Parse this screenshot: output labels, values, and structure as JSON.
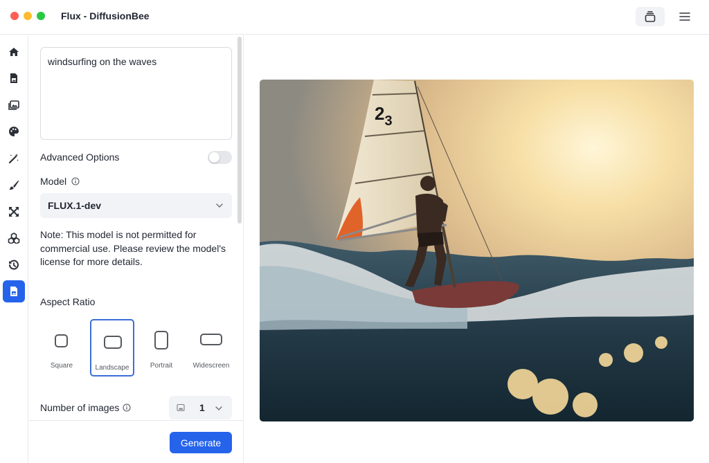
{
  "window": {
    "title": "Flux - DiffusionBee"
  },
  "toolbar": {
    "icons": [
      "stack-icon",
      "hamburger-menu-icon"
    ]
  },
  "rail": {
    "items": [
      {
        "icon": "home-icon"
      },
      {
        "icon": "document-image-icon"
      },
      {
        "icon": "images-icon"
      },
      {
        "icon": "palette-icon"
      },
      {
        "icon": "magic-wand-icon"
      },
      {
        "icon": "brush-icon"
      },
      {
        "icon": "expand-arrows-icon"
      },
      {
        "icon": "models-cube-icon"
      },
      {
        "icon": "history-icon"
      },
      {
        "icon": "document-image-icon",
        "active": true
      }
    ],
    "active_color": "#2563eb"
  },
  "prompt": {
    "value": "windsurfing on the waves"
  },
  "advanced_options": {
    "label": "Advanced Options",
    "enabled": false
  },
  "model": {
    "label": "Model",
    "selected": "FLUX.1-dev",
    "note": "Note: This model is not permitted for commercial use. Please review the model's license for more details."
  },
  "aspect_ratio": {
    "label": "Aspect Ratio",
    "options": [
      {
        "label": "Square",
        "selected": false
      },
      {
        "label": "Landscape",
        "selected": true
      },
      {
        "label": "Portrait",
        "selected": false
      },
      {
        "label": "Widescreen",
        "selected": false
      }
    ]
  },
  "num_images": {
    "label": "Number of images",
    "value": "1"
  },
  "generate": {
    "label": "Generate"
  },
  "output_image": {
    "sail_number": "23"
  },
  "colors": {
    "accent": "#2563eb",
    "selected_border": "#3b6fd6"
  }
}
